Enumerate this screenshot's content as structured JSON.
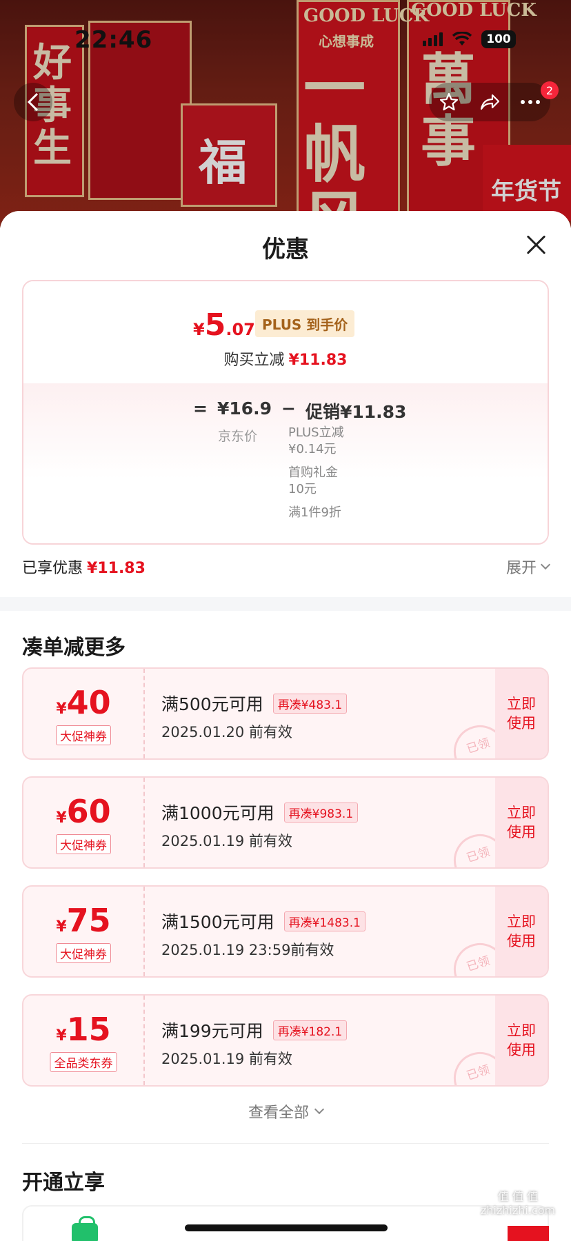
{
  "status_bar": {
    "time": "22:46",
    "battery": "100"
  },
  "nav": {
    "badge": "2"
  },
  "hero": {
    "banner_text_left": "好事生",
    "banner_text_fu": "福",
    "banner_text_center": "一帆风",
    "banner_text_right": "萬事",
    "good_luck_1": "GOOD LUCK",
    "good_luck_sub": "心想事成",
    "good_luck_2": "GOOD LUCK",
    "new_year_market": "年货节"
  },
  "sheet": {
    "title": "优惠",
    "price_card": {
      "final_price_currency": "¥",
      "final_price_int": "5",
      "final_price_dec": ".07",
      "plus_tag": "PLUS 到手价",
      "buy_cut_label": "购买立减",
      "buy_cut_amount": "¥11.83",
      "equals": "=",
      "jd_price": "¥16.9",
      "minus": "−",
      "promo_total": "促销¥11.83",
      "jd_price_label": "京东价",
      "promos": [
        "PLUS立减",
        "¥0.14元",
        "首购礼金",
        "10元",
        "满1件9折"
      ]
    },
    "enjoyed_label": "已享优惠",
    "enjoyed_amount": "¥11.83",
    "expand_label": "展开",
    "more_section_title": "凑单减更多",
    "coupons": [
      {
        "currency": "¥",
        "amount": "40",
        "type": "大促神券",
        "condition": "满500元可用",
        "more": "再凑¥483.1",
        "validity": "2025.01.20 前有效",
        "use": "立即使用",
        "stamp": "已领"
      },
      {
        "currency": "¥",
        "amount": "60",
        "type": "大促神券",
        "condition": "满1000元可用",
        "more": "再凑¥983.1",
        "validity": "2025.01.19 前有效",
        "use": "立即使用",
        "stamp": "已领"
      },
      {
        "currency": "¥",
        "amount": "75",
        "type": "大促神券",
        "condition": "满1500元可用",
        "more": "再凑¥1483.1",
        "validity": "2025.01.19 23:59前有效",
        "use": "立即使用",
        "stamp": "已领"
      },
      {
        "currency": "¥",
        "amount": "15",
        "type": "全品类东券",
        "condition": "满199元可用",
        "more": "再凑¥182.1",
        "validity": "2025.01.19 前有效",
        "use": "立即使用",
        "stamp": "已领"
      }
    ],
    "view_all": "查看全部",
    "open_section_title": "开通立享"
  },
  "watermark": "值 值 值\nzhizhizhi.com"
}
